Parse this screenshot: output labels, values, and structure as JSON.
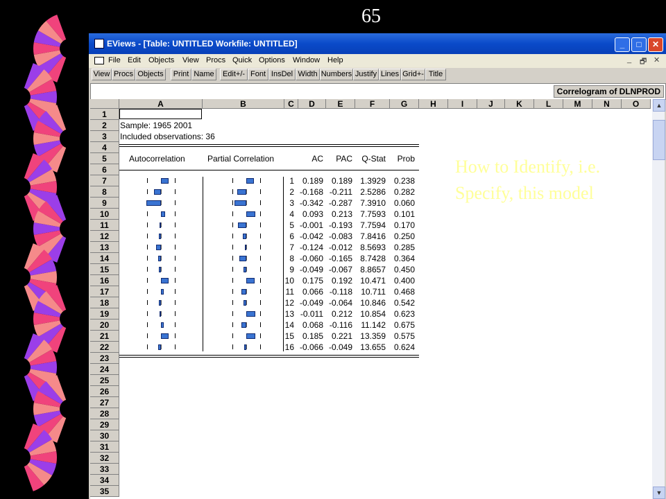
{
  "slide_number": "65",
  "window": {
    "title": "EViews - [Table: UNTITLED   Workfile: UNTITLED]",
    "min_glyph": "_",
    "max_glyph": "□",
    "close_glyph": "✕"
  },
  "menu": [
    "File",
    "Edit",
    "Objects",
    "View",
    "Procs",
    "Quick",
    "Options",
    "Window",
    "Help"
  ],
  "doc_controls": [
    "_",
    "🗗",
    "✕"
  ],
  "toolbar": [
    "View",
    "Procs",
    "Objects",
    "Print",
    "Name",
    "Edit+/-",
    "Font",
    "InsDel",
    "Width",
    "Numbers",
    "Justify",
    "Lines",
    "Grid+-",
    "Title"
  ],
  "caption": "Correlogram of DLNPROD",
  "columns": [
    "A",
    "B",
    "C",
    "D",
    "E",
    "F",
    "G",
    "H",
    "I",
    "J",
    "K",
    "L",
    "M",
    "N",
    "O"
  ],
  "rows": [
    "1",
    "2",
    "3",
    "4",
    "5",
    "6",
    "7",
    "8",
    "9",
    "10",
    "11",
    "12",
    "13",
    "14",
    "15",
    "16",
    "17",
    "18",
    "19",
    "20",
    "21",
    "22",
    "23",
    "24",
    "25",
    "26",
    "27",
    "28",
    "29",
    "30",
    "31",
    "32",
    "33",
    "34",
    "35"
  ],
  "sample": "Sample: 1965 2001",
  "included": "Included observations: 36",
  "headers": {
    "autocorrelation": "Autocorrelation",
    "partial": "Partial Correlation",
    "ac": "AC",
    "pac": "PAC",
    "qstat": "Q-Stat",
    "prob": "Prob"
  },
  "table": [
    {
      "lag": "1",
      "ac": "0.189",
      "pac": "0.189",
      "q": "1.3929",
      "prob": "0.238"
    },
    {
      "lag": "2",
      "ac": "-0.168",
      "pac": "-0.211",
      "q": "2.5286",
      "prob": "0.282"
    },
    {
      "lag": "3",
      "ac": "-0.342",
      "pac": "-0.287",
      "q": "7.3910",
      "prob": "0.060"
    },
    {
      "lag": "4",
      "ac": "0.093",
      "pac": "0.213",
      "q": "7.7593",
      "prob": "0.101"
    },
    {
      "lag": "5",
      "ac": "-0.001",
      "pac": "-0.193",
      "q": "7.7594",
      "prob": "0.170"
    },
    {
      "lag": "6",
      "ac": "-0.042",
      "pac": "-0.083",
      "q": "7.8416",
      "prob": "0.250"
    },
    {
      "lag": "7",
      "ac": "-0.124",
      "pac": "-0.012",
      "q": "8.5693",
      "prob": "0.285"
    },
    {
      "lag": "8",
      "ac": "-0.060",
      "pac": "-0.165",
      "q": "8.7428",
      "prob": "0.364"
    },
    {
      "lag": "9",
      "ac": "-0.049",
      "pac": "-0.067",
      "q": "8.8657",
      "prob": "0.450"
    },
    {
      "lag": "10",
      "ac": "0.175",
      "pac": "0.192",
      "q": "10.471",
      "prob": "0.400"
    },
    {
      "lag": "11",
      "ac": "0.066",
      "pac": "-0.118",
      "q": "10.711",
      "prob": "0.468"
    },
    {
      "lag": "12",
      "ac": "-0.049",
      "pac": "-0.064",
      "q": "10.846",
      "prob": "0.542"
    },
    {
      "lag": "13",
      "ac": "-0.011",
      "pac": "0.212",
      "q": "10.854",
      "prob": "0.623"
    },
    {
      "lag": "14",
      "ac": "0.068",
      "pac": "-0.116",
      "q": "11.142",
      "prob": "0.675"
    },
    {
      "lag": "15",
      "ac": "0.185",
      "pac": "0.221",
      "q": "13.359",
      "prob": "0.575"
    },
    {
      "lag": "16",
      "ac": "-0.066",
      "pac": "-0.049",
      "q": "13.655",
      "prob": "0.624"
    }
  ],
  "overlay": [
    "How to Identify, i.e.",
    "Specify, this model"
  ],
  "colors": {
    "bar": "#3a74d2",
    "overlay_text": "#ffff99",
    "ornament_pink": "#f0437c",
    "ornament_purple": "#9b3ee8",
    "ornament_salmon": "#f58a8a"
  }
}
